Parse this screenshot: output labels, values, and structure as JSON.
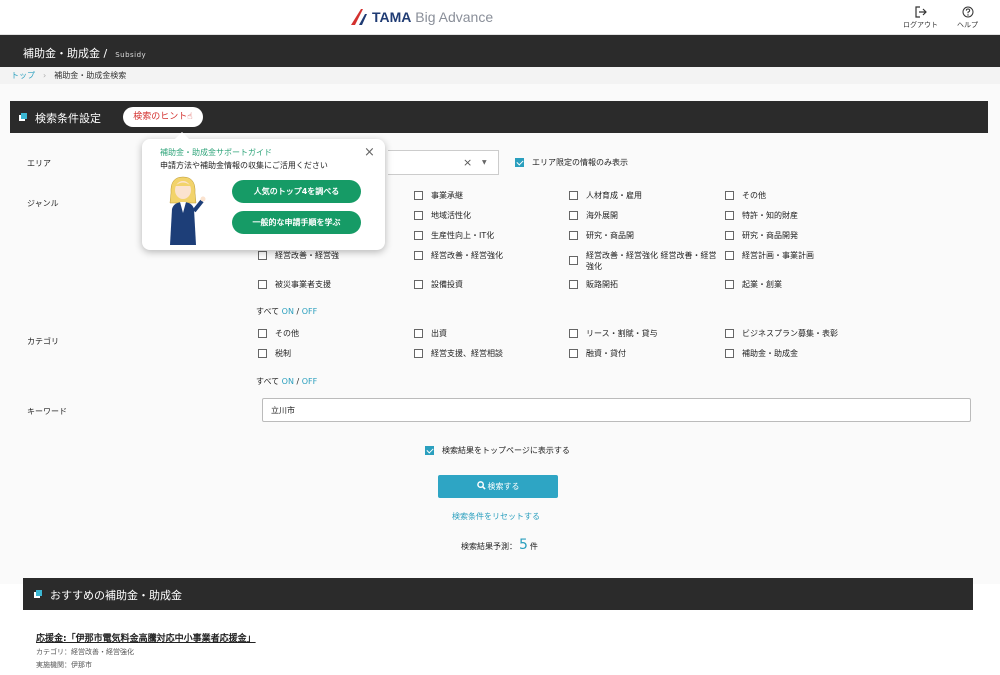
{
  "header": {
    "logo_tama": "TAMA",
    "logo_rest": "Big Advance",
    "logout_label": "ログアウト",
    "help_label": "ヘルプ"
  },
  "subheader": {
    "title": "補助金・助成金 /",
    "subtitle": "Subsidy"
  },
  "breadcrumb": {
    "home": "トップ",
    "current": "補助金・助成金検索"
  },
  "search_panel": {
    "title": "検索条件設定",
    "hint_button": "検索のヒント",
    "area_label": "エリア",
    "area_clear": "×",
    "area_only_label": "エリア限定の情報のみ表示",
    "genre_label": "ジャンル",
    "genre_options": [
      "事業承継",
      "人材育成・雇用",
      "その他",
      "地域活性化",
      "海外展開",
      "特許・知的財産",
      "生産性向上・IT化",
      "研究・商品開",
      "研究・商品開発",
      "経営改善・経営強",
      "経営改善・経営強化",
      "経営改善・経営強化 経営改善・経営強化",
      "経営計画・事業計画",
      "被災事業者支援",
      "設備投資",
      "販路開拓",
      "起業・創業"
    ],
    "all_label": "すべて",
    "on_label": "ON",
    "slash": "/",
    "off_label": "OFF",
    "category_label": "カテゴリ",
    "category_options": [
      "その他",
      "出資",
      "リース・割賦・貸与",
      "ビジネスプラン募集・表彰",
      "税制",
      "経営支援、経営相談",
      "融資・貸付",
      "補助金・助成金"
    ],
    "keyword_label": "キーワード",
    "keyword_value": "立川市",
    "show_on_top_label": "検索結果をトップページに表示する",
    "search_button": "検索する",
    "reset_link": "検索条件をリセットする",
    "forecast_prefix": "検索結果予測：",
    "forecast_count": "5",
    "forecast_suffix": "件"
  },
  "recommend": {
    "title": "おすすめの補助金・助成金",
    "item_title": "応援金:「伊那市電気料金高騰対応中小事業者応援金」",
    "item_category": "カテゴリ：経営改善・経営強化",
    "item_org": "実施機関：伊那市"
  },
  "popup": {
    "title": "補助金・助成金サポートガイド",
    "subtitle": "申請方法や補助金情報の収集にご活用ください",
    "button1": "人気のトップ4を調べる",
    "button2": "一般的な申請手順を学ぶ",
    "close": "×"
  },
  "colors": {
    "accent": "#2a9fbe",
    "dark": "#2b2b2b",
    "popup_green": "#169b66",
    "hint_red": "#d3312f"
  }
}
